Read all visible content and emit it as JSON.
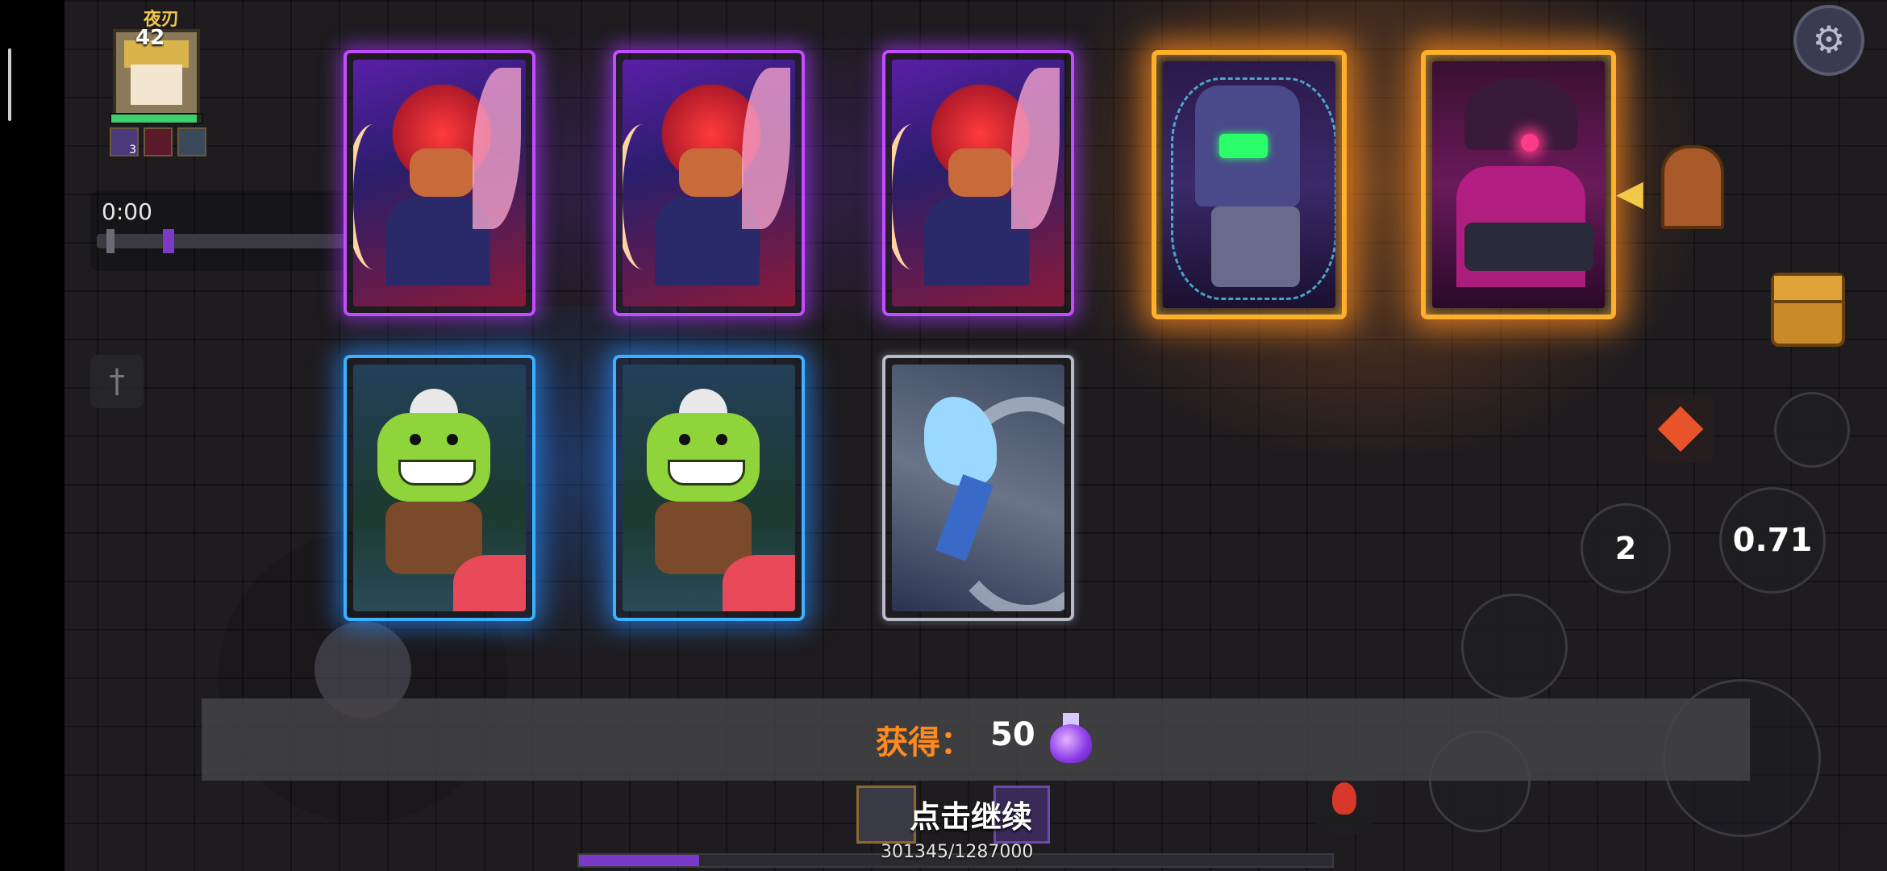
{
  "player": {
    "name": "夜刃",
    "level": "42",
    "hp_fraction": 0.95,
    "buffs": [
      {
        "icon": "card-buff-icon",
        "count": "3"
      },
      {
        "icon": "red-eye-buff-icon",
        "count": ""
      },
      {
        "icon": "shield-buff-icon",
        "count": ""
      }
    ]
  },
  "timer": {
    "time": "0:00"
  },
  "cards": [
    {
      "rarity": "epic",
      "frame_color": "#c44cff",
      "art": "red-haired-demon-card"
    },
    {
      "rarity": "epic",
      "frame_color": "#c44cff",
      "art": "red-haired-demon-card"
    },
    {
      "rarity": "epic",
      "frame_color": "#c44cff",
      "art": "red-haired-demon-card"
    },
    {
      "rarity": "legendary",
      "frame_color": "#ffb02a",
      "art": "armored-robot-card"
    },
    {
      "rarity": "legendary",
      "frame_color": "#ffb02a",
      "art": "dark-witch-card"
    },
    {
      "rarity": "rare",
      "frame_color": "#3ab2ff",
      "art": "green-goblin-card"
    },
    {
      "rarity": "rare",
      "frame_color": "#3ab2ff",
      "art": "green-goblin-card"
    },
    {
      "rarity": "common",
      "frame_color": "#b8bcc8",
      "art": "ice-ninja-card"
    }
  ],
  "skills": {
    "skill_a_value": "2",
    "skill_b_value": "0.71"
  },
  "reward": {
    "label": "获得：",
    "amount": "50",
    "currency_icon": "purple-gem-icon"
  },
  "continue_label": "点击继续",
  "experience": {
    "text": "301345/1287000",
    "progress_fraction": 0.16
  },
  "colors": {
    "reward_label": "#ff8a1e",
    "epic": "#c44cff",
    "legendary": "#ffb02a",
    "rare": "#3ab2ff"
  }
}
